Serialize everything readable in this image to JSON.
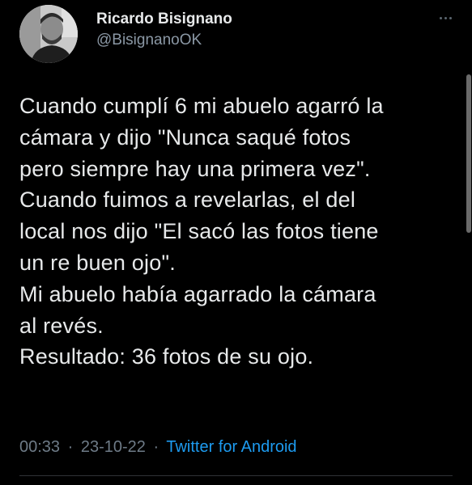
{
  "author": {
    "display_name": "Ricardo Bisignano",
    "handle": "@BisignanoOK",
    "avatar_icon": "profile-photo"
  },
  "menu": {
    "icon": "more-horizontal-icon"
  },
  "tweet": {
    "lines": [
      "Cuando cumplí 6 mi abuelo agarró la",
      "cámara y dijo \"Nunca saqué fotos",
      "pero siempre hay una primera vez\".",
      "Cuando fuimos a revelarlas, el del",
      "local nos dijo \"El sacó las fotos tiene",
      "un re buen ojo\".",
      "Mi abuelo había agarrado la cámara",
      "al revés.",
      "Resultado: 36 fotos de su ojo."
    ]
  },
  "meta": {
    "time": "00:33",
    "date": "23-10-22",
    "separator": "·",
    "source": "Twitter for Android"
  },
  "colors": {
    "background": "#000000",
    "text": "#e7e9ea",
    "secondary": "#8b98a5",
    "link": "#1d9bf0"
  }
}
